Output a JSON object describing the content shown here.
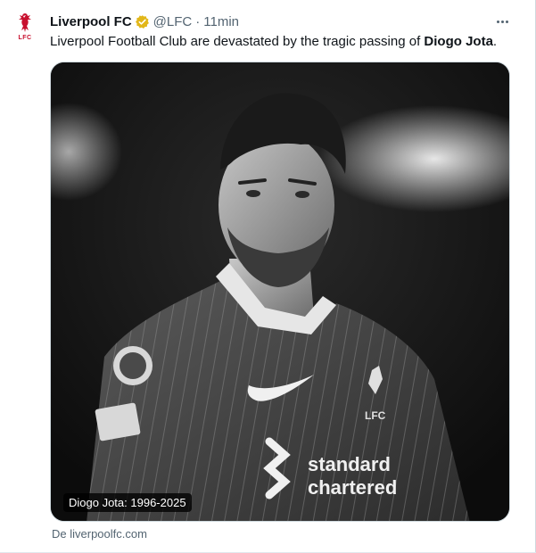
{
  "tweet": {
    "author_name": "Liverpool FC",
    "handle": "@LFC",
    "separator": "·",
    "time": "11min",
    "avatar_label": "LFC",
    "text_prefix": "Liverpool Football Club are devastated by the tragic passing of ",
    "text_bold": "Diogo Jota",
    "text_suffix": ".",
    "media_caption": "Diogo Jota: 1996-2025",
    "source": "De liverpoolfc.com"
  },
  "icons": {
    "verified": "verified-badge-icon",
    "more": "more-options-icon",
    "crest": "liverbird-crest-icon"
  },
  "colors": {
    "brand_red": "#c8102e",
    "verified_gold": "#e2b719",
    "text_primary": "#0f1419",
    "text_secondary": "#536471"
  }
}
